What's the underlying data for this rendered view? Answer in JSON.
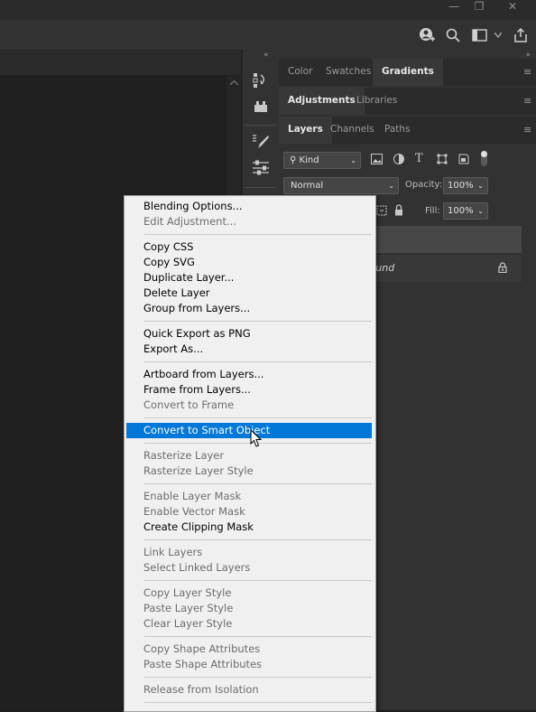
{
  "menu": {
    "items": [
      {
        "label": "Blending Options...",
        "enabled": true
      },
      {
        "label": "Edit Adjustment...",
        "enabled": false
      },
      {
        "label": "Copy CSS",
        "enabled": true
      },
      {
        "label": "Copy SVG",
        "enabled": true
      },
      {
        "label": "Duplicate Layer...",
        "enabled": true
      },
      {
        "label": "Delete Layer",
        "enabled": true
      },
      {
        "label": "Group from Layers...",
        "enabled": true
      },
      {
        "label": "Quick Export as PNG",
        "enabled": true
      },
      {
        "label": "Export As...",
        "enabled": true
      },
      {
        "label": "Artboard from Layers...",
        "enabled": true
      },
      {
        "label": "Frame from Layers...",
        "enabled": true
      },
      {
        "label": "Convert to Frame",
        "enabled": false
      },
      {
        "label": "Convert to Smart Object",
        "enabled": true,
        "highlighted": true
      },
      {
        "label": "Rasterize Layer",
        "enabled": false
      },
      {
        "label": "Rasterize Layer Style",
        "enabled": false
      },
      {
        "label": "Enable Layer Mask",
        "enabled": false
      },
      {
        "label": "Enable Vector Mask",
        "enabled": false
      },
      {
        "label": "Create Clipping Mask",
        "enabled": true
      },
      {
        "label": "Link Layers",
        "enabled": false
      },
      {
        "label": "Select Linked Layers",
        "enabled": false
      },
      {
        "label": "Copy Layer Style",
        "enabled": false
      },
      {
        "label": "Paste Layer Style",
        "enabled": false
      },
      {
        "label": "Clear Layer Style",
        "enabled": false
      },
      {
        "label": "Copy Shape Attributes",
        "enabled": false
      },
      {
        "label": "Paste Shape Attributes",
        "enabled": false
      },
      {
        "label": "Release from Isolation",
        "enabled": false
      }
    ]
  },
  "panels": {
    "row1_tabs": [
      "Color",
      "Swatches",
      "Gradients"
    ],
    "row1_active": "Gradients",
    "row2_tabs": [
      "Adjustments",
      "Libraries"
    ],
    "row2_active": "Adjustments",
    "row3_tabs": [
      "Layers",
      "Channels",
      "Paths"
    ],
    "row3_active": "Layers",
    "filter_kind": "Kind",
    "blend_mode": "Normal",
    "opacity_label": "Opacity:",
    "opacity_value": "100%",
    "fill_label": "Fill:",
    "fill_value": "100%",
    "layer_name_partial": "round"
  },
  "colors": {
    "highlight": "#0078d7",
    "menu_bg": "#f0f0f0",
    "panel_bg": "#323232"
  }
}
